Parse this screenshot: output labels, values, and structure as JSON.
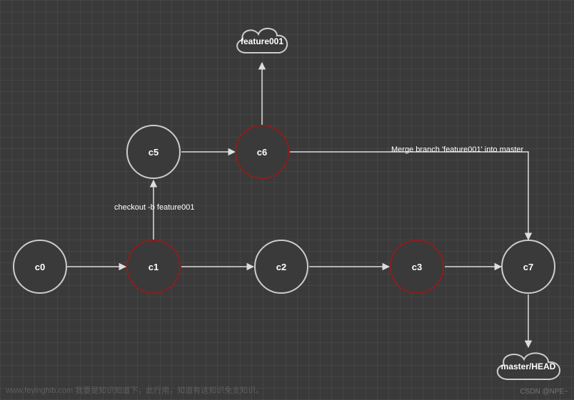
{
  "chart_data": {
    "type": "diagram",
    "title": "",
    "nodes": [
      {
        "id": "c0",
        "label": "c0",
        "highlight": false
      },
      {
        "id": "c1",
        "label": "c1",
        "highlight": true
      },
      {
        "id": "c2",
        "label": "c2",
        "highlight": false
      },
      {
        "id": "c3",
        "label": "c3",
        "highlight": true
      },
      {
        "id": "c5",
        "label": "c5",
        "highlight": false
      },
      {
        "id": "c6",
        "label": "c6",
        "highlight": true
      },
      {
        "id": "c7",
        "label": "c7",
        "highlight": false
      }
    ],
    "refs": [
      {
        "id": "feature001",
        "label": "feature001",
        "points_to": "c6"
      },
      {
        "id": "master_head",
        "label": "master/HEAD",
        "points_to": "c7"
      }
    ],
    "edges": [
      {
        "from": "c0",
        "to": "c1",
        "label": ""
      },
      {
        "from": "c1",
        "to": "c2",
        "label": ""
      },
      {
        "from": "c2",
        "to": "c3",
        "label": ""
      },
      {
        "from": "c3",
        "to": "c7",
        "label": ""
      },
      {
        "from": "c1",
        "to": "c5",
        "label": "checkout -b feature001"
      },
      {
        "from": "c5",
        "to": "c6",
        "label": ""
      },
      {
        "from": "c6",
        "to": "feature001",
        "label": ""
      },
      {
        "from": "c6",
        "to": "c7",
        "label": "Merge branch 'feature001' into master"
      },
      {
        "from": "c7",
        "to": "master_head",
        "label": ""
      }
    ]
  },
  "labels": {
    "c0": "c0",
    "c1": "c1",
    "c2": "c2",
    "c3": "c3",
    "c5": "c5",
    "c6": "c6",
    "c7": "c7",
    "feature001": "feature001",
    "master_head": "master/HEAD",
    "checkout": "checkout -b feature001",
    "merge": "Merge branch 'feature001' into master"
  },
  "watermark": {
    "left": "www.feyinghib.com 我要是知识知道下，此行用，知道有这知识免支知识。",
    "right": "CSDN @NPE~"
  }
}
